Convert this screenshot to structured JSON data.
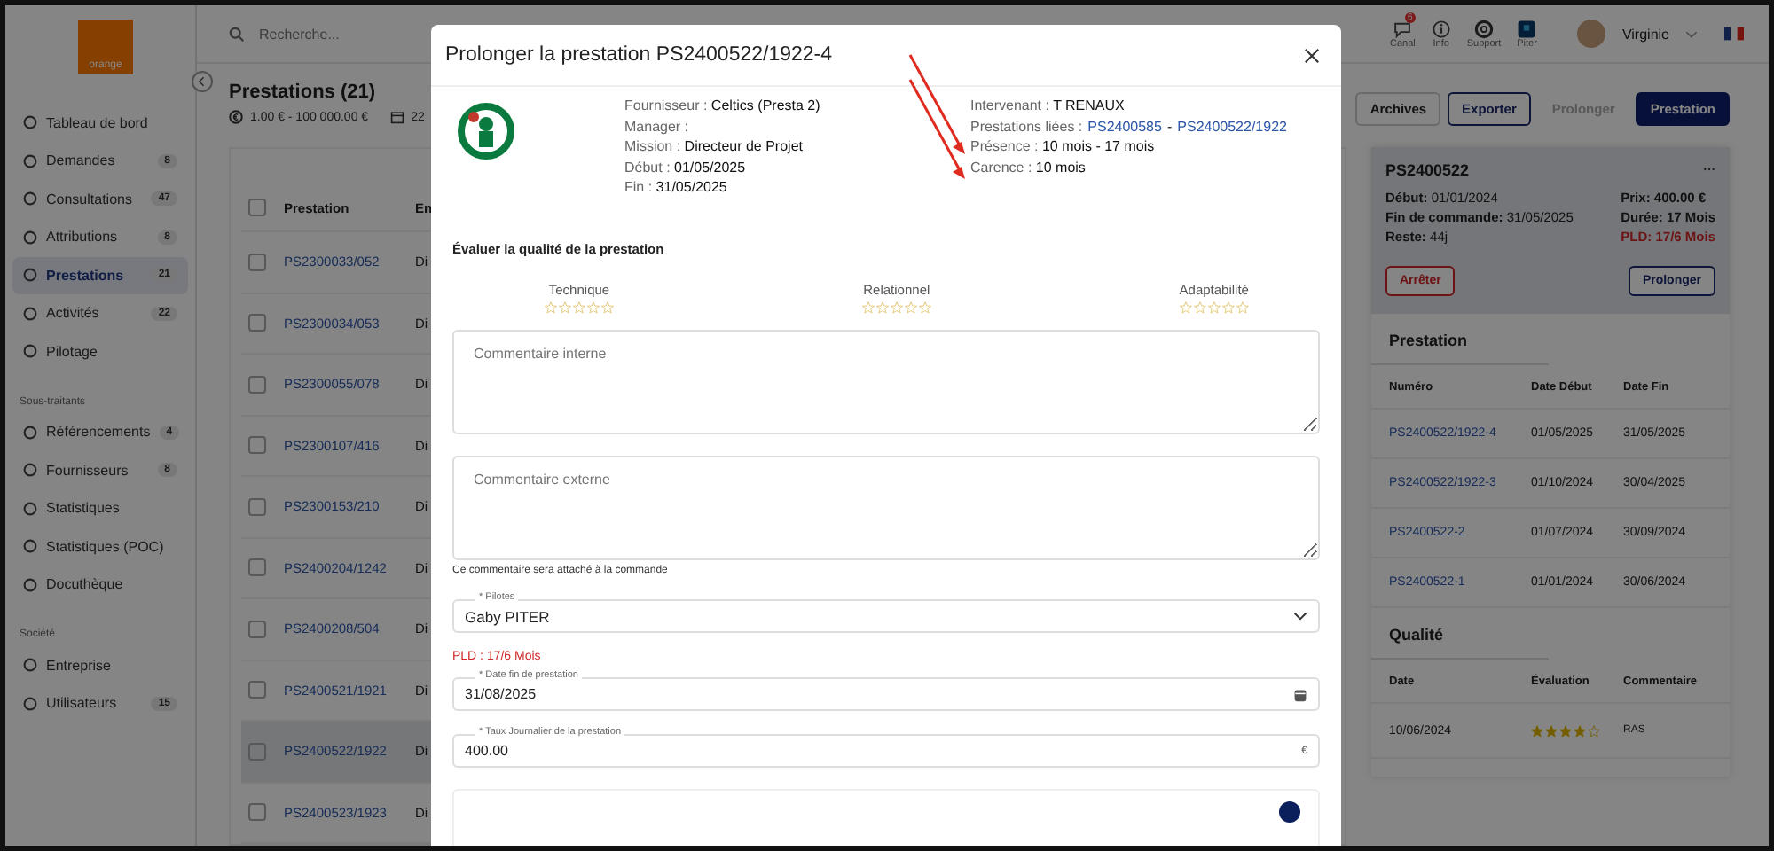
{
  "topbar": {
    "search_placeholder": "Recherche...",
    "icons": [
      {
        "kind": "chat",
        "label": "Canal",
        "badge": "6"
      },
      {
        "kind": "info",
        "label": "Info"
      },
      {
        "kind": "support",
        "label": "Support"
      },
      {
        "kind": "piter",
        "label": "Piter"
      }
    ],
    "user": "Virginie"
  },
  "sidebar": {
    "logo": "orange",
    "sections": [
      {
        "items": [
          {
            "label": "Tableau de bord",
            "selected": false
          },
          {
            "label": "Demandes",
            "count": "8",
            "selected": false
          },
          {
            "label": "Consultations",
            "count": "47",
            "selected": false
          },
          {
            "label": "Attributions",
            "count": "8",
            "selected": false
          },
          {
            "label": "Prestations",
            "count": "21",
            "selected": true
          },
          {
            "label": "Activités",
            "count": "22",
            "selected": false
          },
          {
            "label": "Pilotage",
            "selected": false
          }
        ]
      },
      {
        "title": "Sous-traitants",
        "items": [
          {
            "label": "Référencements",
            "count": "4",
            "selected": false
          },
          {
            "label": "Fournisseurs",
            "count": "8",
            "selected": false
          },
          {
            "label": "Statistiques",
            "selected": false
          },
          {
            "label": "Statistiques (POC)",
            "selected": false
          },
          {
            "label": "Docuthèque",
            "selected": false
          }
        ]
      },
      {
        "title": "Société",
        "items": [
          {
            "label": "Entreprise",
            "selected": false
          },
          {
            "label": "Utilisateurs",
            "count": "15",
            "selected": false
          }
        ]
      }
    ]
  },
  "page": {
    "title": "Prestations (21)",
    "price_filter": "1.00 € - 100 000.00 €",
    "date_filter": "22"
  },
  "toolbar": [
    {
      "kind": "plain",
      "label": "Archives",
      "disabled": false
    },
    {
      "kind": "outline",
      "label": "Exporter",
      "disabled": false
    },
    {
      "kind": "plain",
      "label": "Prolonger",
      "disabled": true
    },
    {
      "kind": "primary",
      "label": "Prestation",
      "disabled": false
    }
  ],
  "table": {
    "columns": [
      "Prestation",
      "En"
    ],
    "header_checked": false,
    "rows": [
      {
        "id": "PS2300033/052",
        "column_2": "Di",
        "checked": false,
        "selected": false
      },
      {
        "id": "PS2300034/053",
        "column_2": "Di",
        "checked": false,
        "selected": false
      },
      {
        "id": "PS2300055/078",
        "column_2": "Di",
        "checked": false,
        "selected": false
      },
      {
        "id": "PS2300107/416",
        "column_2": "Di",
        "checked": false,
        "selected": false
      },
      {
        "id": "PS2300153/210",
        "column_2": "Di",
        "checked": false,
        "selected": false
      },
      {
        "id": "PS2400204/1242",
        "column_2": "Di",
        "checked": false,
        "selected": false
      },
      {
        "id": "PS2400208/504",
        "column_2": "Di",
        "checked": false,
        "selected": false
      },
      {
        "id": "PS2400521/1921",
        "column_2": "Di",
        "checked": false,
        "selected": false
      },
      {
        "id": "PS2400522/1922",
        "column_2": "Di",
        "checked": false,
        "selected": true
      },
      {
        "id": "PS2400523/1923",
        "column_2": "Di",
        "checked": false,
        "selected": false
      }
    ]
  },
  "detail": {
    "title": "PS2400522",
    "left": [
      "**Début:** 01/01/2024",
      "**Fin de commande:** 31/05/2025",
      "**Reste:** 44j"
    ],
    "right": [
      {
        "text": "Prix: 400.00 €",
        "alert": false
      },
      {
        "text": "Durée: 17 Mois",
        "alert": false
      },
      {
        "text": "PLD: 17/6 Mois",
        "alert": true
      }
    ],
    "stop_button": "Arrêter",
    "extend_button": "Prolonger",
    "prestations": {
      "title": "Prestation",
      "columns": [
        "Numéro",
        "Date Début",
        "Date Fin"
      ],
      "rows": [
        [
          "PS2400522/1922-4",
          "01/05/2025",
          "31/05/2025"
        ],
        [
          "PS2400522/1922-3",
          "01/10/2024",
          "30/04/2025"
        ],
        [
          "PS2400522-2",
          "01/07/2024",
          "30/09/2024"
        ],
        [
          "PS2400522-1",
          "01/01/2024",
          "30/06/2024"
        ]
      ]
    },
    "quality": {
      "title": "Qualité",
      "columns": [
        "Date",
        "Évaluation",
        "Commentaire"
      ],
      "rows": [
        {
          "date": "10/06/2024",
          "stars": 4,
          "comment": "RAS"
        }
      ]
    }
  },
  "modal": {
    "title": "Prolonger la prestation PS2400522/1922-4",
    "info_left": [
      {
        "label": "Fournisseur :",
        "value": "Celtics (Presta 2)"
      },
      {
        "label": "Manager :"
      },
      {
        "label": "Mission :",
        "value": "Directeur de Projet"
      },
      {
        "label": "Début :",
        "value": "01/05/2025"
      },
      {
        "label": "Fin :",
        "value": "31/05/2025"
      }
    ],
    "info_right": [
      {
        "label": "Intervenant :",
        "value": "T RENAUX"
      },
      {
        "label": "Prestations liées :",
        "links": [
          "PS2400585",
          "PS2400522/1922"
        ],
        "link_separator": "-"
      },
      {
        "label": "Présence :",
        "value": "10 mois - 17 mois"
      },
      {
        "label": "Carence :",
        "value": "10 mois"
      }
    ],
    "rating_title": "Évaluer la qualité de la prestation",
    "criteria": [
      {
        "label": "Technique",
        "stars": 0
      },
      {
        "label": "Relationnel",
        "stars": 0
      },
      {
        "label": "Adaptabilité",
        "stars": 0
      }
    ],
    "internal_comment": {
      "placeholder": "Commentaire interne"
    },
    "external_comment": {
      "placeholder": "Commentaire externe",
      "help": "Ce commentaire sera attaché à la commande"
    },
    "pilot": {
      "label": "* Pilotes",
      "value": "Gaby PITER"
    },
    "pld": "PLD :  17/6 Mois",
    "end_date": {
      "label": "* Date fin de prestation",
      "value": "31/08/2025"
    },
    "rate": {
      "label": "* Taux Journalier de la prestation",
      "value": "400.00",
      "suffix": "€"
    }
  }
}
